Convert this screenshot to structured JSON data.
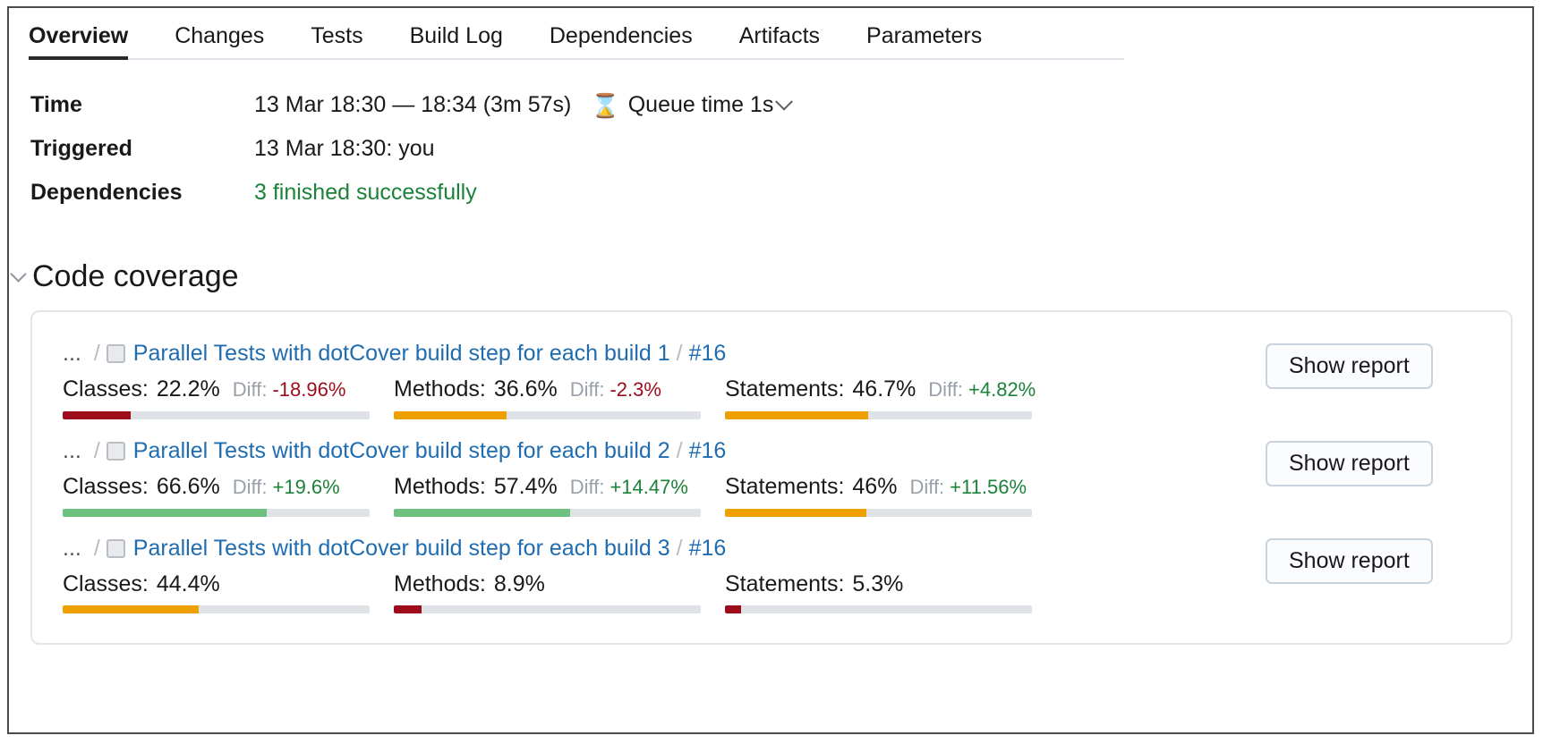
{
  "tabs": [
    {
      "label": "Overview",
      "active": true
    },
    {
      "label": "Changes",
      "active": false
    },
    {
      "label": "Tests",
      "active": false
    },
    {
      "label": "Build Log",
      "active": false
    },
    {
      "label": "Dependencies",
      "active": false
    },
    {
      "label": "Artifacts",
      "active": false
    },
    {
      "label": "Parameters",
      "active": false
    }
  ],
  "info": {
    "time": {
      "label": "Time",
      "value": "13 Mar 18:30 — 18:34 (3m 57s)",
      "queue_icon": "hourglass-icon",
      "queue_label": "Queue time 1s",
      "queue_chevron": "chevron-down-icon"
    },
    "triggered": {
      "label": "Triggered",
      "value": "13 Mar 18:30: you"
    },
    "dependencies": {
      "label": "Dependencies",
      "value": "3 finished successfully",
      "color": "#1c8139"
    }
  },
  "section": {
    "chevron": "chevron-down-icon",
    "title": "Code coverage"
  },
  "colors": {
    "red": "#9e0b1a",
    "orange": "#eea001",
    "green": "#6cc17e",
    "track": "#dfe3e8",
    "link": "#1f6cb0",
    "success": "#1c8139",
    "diff_label": "#9aa0a8"
  },
  "coverage_rows": [
    {
      "breadcrumb_dots": "...",
      "sep": "/",
      "config_icon": "build-config-icon",
      "config_name": "Parallel Tests with dotCover build step for each build 1",
      "build_number": "#16",
      "button_label": "Show report",
      "metrics": [
        {
          "name": "Classes:",
          "pct": "22.2%",
          "value": 22.2,
          "diff_label": "Diff:",
          "diff": "-18.96%",
          "diff_sign": "neg",
          "bar_color": "#9e0b1a"
        },
        {
          "name": "Methods:",
          "pct": "36.6%",
          "value": 36.6,
          "diff_label": "Diff:",
          "diff": "-2.3%",
          "diff_sign": "neg",
          "bar_color": "#eea001"
        },
        {
          "name": "Statements:",
          "pct": "46.7%",
          "value": 46.7,
          "diff_label": "Diff:",
          "diff": "+4.82%",
          "diff_sign": "pos",
          "bar_color": "#eea001"
        }
      ]
    },
    {
      "breadcrumb_dots": "...",
      "sep": "/",
      "config_icon": "build-config-icon",
      "config_name": "Parallel Tests with dotCover build step for each build 2",
      "build_number": "#16",
      "button_label": "Show report",
      "metrics": [
        {
          "name": "Classes:",
          "pct": "66.6%",
          "value": 66.6,
          "diff_label": "Diff:",
          "diff": "+19.6%",
          "diff_sign": "pos",
          "bar_color": "#6cc17e"
        },
        {
          "name": "Methods:",
          "pct": "57.4%",
          "value": 57.4,
          "diff_label": "Diff:",
          "diff": "+14.47%",
          "diff_sign": "pos",
          "bar_color": "#6cc17e"
        },
        {
          "name": "Statements:",
          "pct": "46%",
          "value": 46,
          "diff_label": "Diff:",
          "diff": "+11.56%",
          "diff_sign": "pos",
          "bar_color": "#eea001"
        }
      ]
    },
    {
      "breadcrumb_dots": "...",
      "sep": "/",
      "config_icon": "build-config-icon",
      "config_name": "Parallel Tests with dotCover build step for each build 3",
      "build_number": "#16",
      "button_label": "Show report",
      "metrics": [
        {
          "name": "Classes:",
          "pct": "44.4%",
          "value": 44.4,
          "diff_label": "",
          "diff": "",
          "diff_sign": "",
          "bar_color": "#eea001"
        },
        {
          "name": "Methods:",
          "pct": "8.9%",
          "value": 8.9,
          "diff_label": "",
          "diff": "",
          "diff_sign": "",
          "bar_color": "#9e0b1a"
        },
        {
          "name": "Statements:",
          "pct": "5.3%",
          "value": 5.3,
          "diff_label": "",
          "diff": "",
          "diff_sign": "",
          "bar_color": "#9e0b1a"
        }
      ]
    }
  ]
}
